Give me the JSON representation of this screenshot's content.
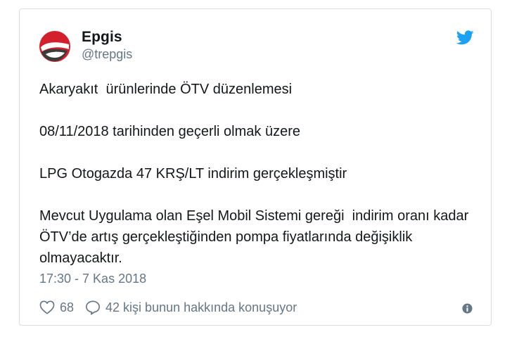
{
  "colors": {
    "twitter_blue": "#1da1f2",
    "text_primary": "#14171a",
    "text_secondary": "#657786",
    "avatar_red": "#d3202d",
    "avatar_dark": "#3b3b3b",
    "border": "#d9dfe4"
  },
  "author": {
    "name": "Epgis",
    "handle": "@trepgis",
    "avatar_icon": "epgis-logo",
    "platform_icon": "twitter-bird-icon"
  },
  "tweet": {
    "paragraphs": [
      "Akaryakıt  ürünlerinde ÖTV düzenlemesi",
      "08/11/2018 tarihinden geçerli olmak üzere",
      "LPG Otogazda 47 KRŞ/LT indirim gerçekleşmiştir",
      "Mevcut Uygulama olan Eşel Mobil Sistemi gereği  indirim oranı kadar ÖTV’de artış gerçekleştiğinden pompa fiyatlarında değişiklik olmayacaktır."
    ],
    "timestamp": "17:30 - 7 Kas 2018"
  },
  "actions": {
    "like_count": "68",
    "like_icon": "heart-icon",
    "reply_text": "42 kişi bunun hakkında konuşuyor",
    "reply_icon": "speech-bubble-icon",
    "info_icon": "info-icon"
  }
}
